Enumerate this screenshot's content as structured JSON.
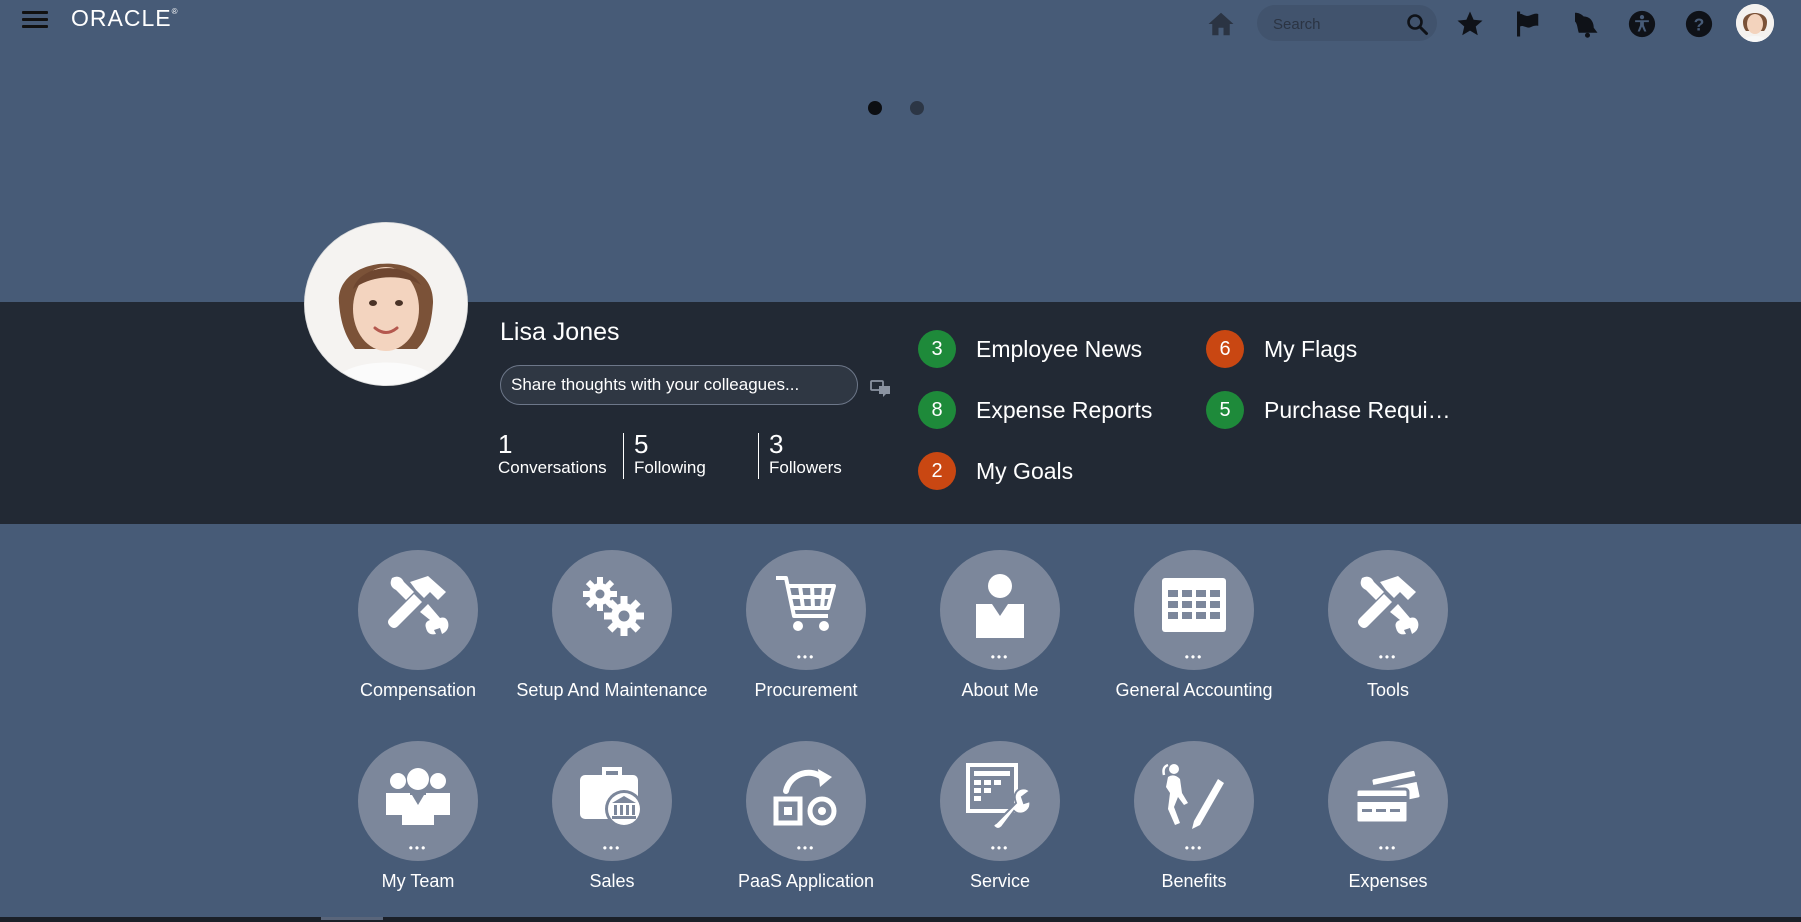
{
  "header": {
    "menu_icon": "hamburger-icon",
    "logo_text": "ORACLE",
    "logo_mark": "®",
    "search_placeholder": "Search",
    "icons": [
      "home-icon",
      "search-icon",
      "star-icon",
      "flag-icon",
      "bell-icon",
      "accessibility-icon",
      "help-icon",
      "avatar"
    ]
  },
  "carousel": {
    "active_index": 0,
    "count": 2,
    "colors": {
      "active": "#0c0e12",
      "inactive": "#2c3645"
    }
  },
  "profile": {
    "name": "Lisa Jones",
    "share_placeholder": "Share thoughts with your colleagues...",
    "stats": [
      {
        "value": "1",
        "label": "Conversations"
      },
      {
        "value": "5",
        "label": "Following"
      },
      {
        "value": "3",
        "label": "Followers"
      }
    ]
  },
  "counters": [
    {
      "count": "3",
      "label": "Employee News",
      "color": "#1e8a3a"
    },
    {
      "count": "6",
      "label": "My Flags",
      "color": "#c94712"
    },
    {
      "count": "8",
      "label": "Expense Reports",
      "color": "#1e8a3a"
    },
    {
      "count": "5",
      "label": "Purchase Requi…",
      "color": "#1e8a3a"
    },
    {
      "count": "2",
      "label": "My Goals",
      "color": "#c94712"
    }
  ],
  "apps": {
    "row1": [
      {
        "label": "Compensation",
        "icon": "tools-icon",
        "more": ""
      },
      {
        "label": "Setup And Maintenance",
        "icon": "gears-icon",
        "more": ""
      },
      {
        "label": "Procurement",
        "icon": "cart-icon",
        "more": "•••"
      },
      {
        "label": "About Me",
        "icon": "person-icon",
        "more": "•••"
      },
      {
        "label": "General Accounting",
        "icon": "ledger-icon",
        "more": "•••"
      },
      {
        "label": "Tools",
        "icon": "tools-icon",
        "more": "•••"
      }
    ],
    "row2": [
      {
        "label": "My Team",
        "icon": "team-icon",
        "more": "•••"
      },
      {
        "label": "Sales",
        "icon": "briefcase-bank-icon",
        "more": "•••"
      },
      {
        "label": "PaaS Application",
        "icon": "paas-icon",
        "more": "•••"
      },
      {
        "label": "Service",
        "icon": "service-icon",
        "more": "•••"
      },
      {
        "label": "Benefits",
        "icon": "benefits-icon",
        "more": "•••"
      },
      {
        "label": "Expenses",
        "icon": "credit-card-icon",
        "more": "•••"
      }
    ]
  },
  "colors": {
    "page_bg": "#475b77",
    "profile_band": "#222934",
    "app_circle": "#7c879b",
    "badge_green": "#1e8a3a",
    "badge_orange": "#c94712"
  }
}
